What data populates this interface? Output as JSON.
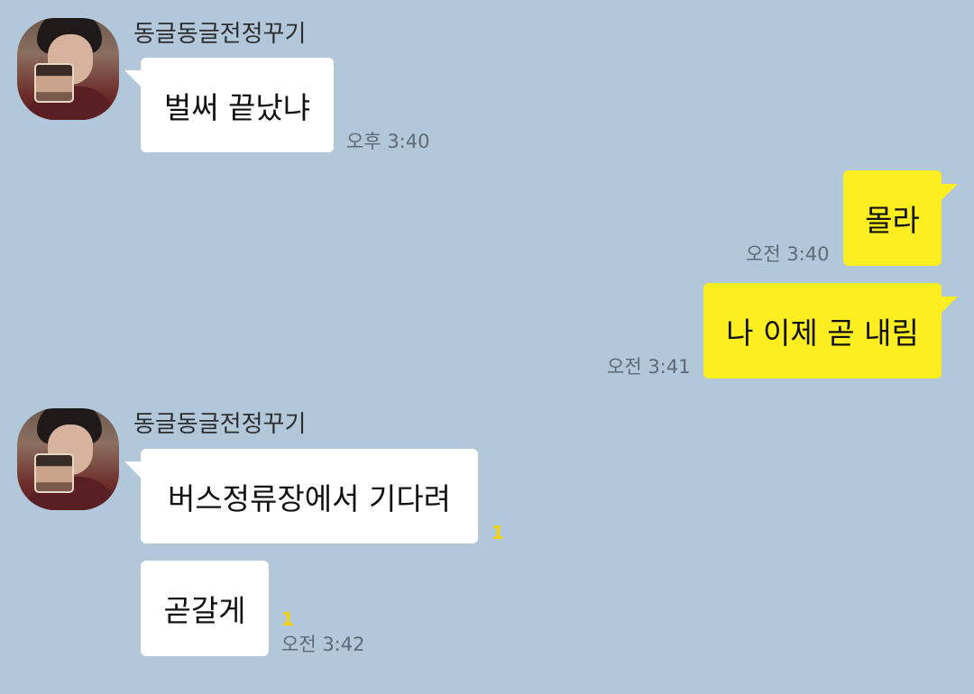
{
  "chat": {
    "messages": [
      {
        "sender": "동글동글전정꾸기",
        "avatar_icon": "profile-photo",
        "text": "벌써 끝났냐",
        "time": "오후 3:40",
        "direction": "incoming"
      },
      {
        "text": "몰라",
        "time": "오전 3:40",
        "direction": "outgoing"
      },
      {
        "text": "나 이제 곧 내림",
        "time": "오전 3:41",
        "direction": "outgoing"
      },
      {
        "sender": "동글동글전정꾸기",
        "avatar_icon": "profile-photo",
        "text": "버스정류장에서 기다려",
        "unread": "1",
        "direction": "incoming"
      },
      {
        "text": "곧갈게",
        "unread": "1",
        "time": "오전 3:42",
        "direction": "incoming"
      }
    ]
  },
  "colors": {
    "background": "#b2c7da",
    "incoming_bubble": "#ffffff",
    "outgoing_bubble": "#fdee21",
    "timestamp": "#5e6a75",
    "unread_count": "#f2d40a"
  }
}
